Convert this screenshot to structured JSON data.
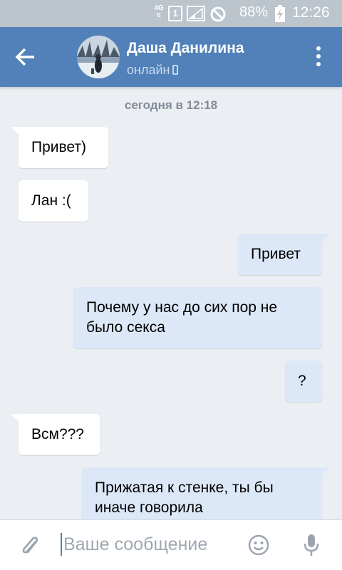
{
  "status_bar": {
    "network": "4G",
    "sim": "1",
    "battery_percent": "88%",
    "time": "12:26"
  },
  "header": {
    "contact_name": "Даша Данилина",
    "contact_status": "онлайн"
  },
  "chat": {
    "date_separator": "сегодня в 12:18",
    "messages": [
      {
        "direction": "in",
        "text": "Привет)"
      },
      {
        "direction": "in",
        "text": "Лан :("
      },
      {
        "direction": "out",
        "text": "Привет"
      },
      {
        "direction": "out",
        "text": "Почему у нас до сих пор не было секса"
      },
      {
        "direction": "out",
        "text": "?"
      },
      {
        "direction": "in",
        "text": "Всм???"
      },
      {
        "direction": "out",
        "text": "Прижатая к стенке, ты бы иначе говорила"
      }
    ]
  },
  "composer": {
    "placeholder": "Ваше сообщение"
  },
  "colors": {
    "header": "#5181b8",
    "background": "#ebeef2",
    "incoming_bubble": "#ffffff",
    "outgoing_bubble": "#dce8f7",
    "status_bar": "#bcc4cc"
  }
}
